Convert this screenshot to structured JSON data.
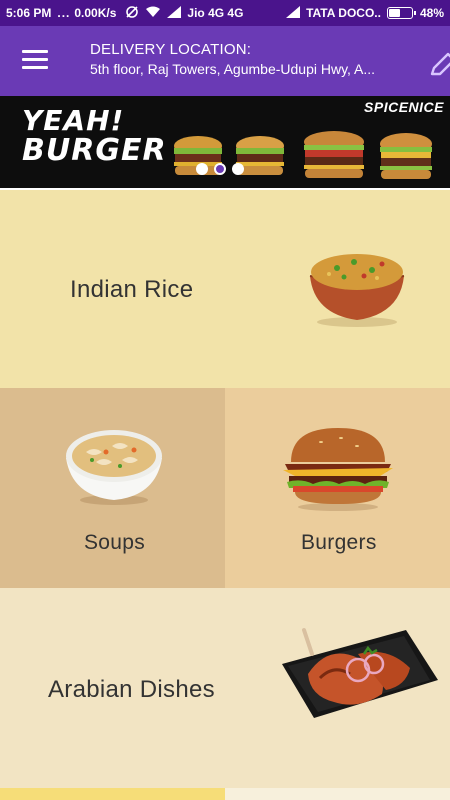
{
  "status_bar": {
    "time": "5:06 PM",
    "dots": "...",
    "speed": "0.00K/s",
    "carrier1": "Jio 4G 4G",
    "carrier2": "TATA DOCO..",
    "battery": "48%",
    "battery_level": 0.48
  },
  "app_bar": {
    "menu_icon": "hamburger-menu-icon",
    "location_title": "DELIVERY LOCATION:",
    "location_address": "5th floor, Raj Towers, Agumbe-Udupi Hwy, A...",
    "edit_icon": "pencil-icon",
    "color": "#6a3ab5"
  },
  "banner": {
    "headline_line1": "YEAH!",
    "headline_line2": "BURGER",
    "brand": "SPICENICE",
    "active_slide": 2,
    "slide_count": 3
  },
  "categories": [
    {
      "label": "Indian Rice",
      "image": "biryani-bowl",
      "color": "#f2e3a9"
    },
    {
      "label": "Soups",
      "image": "soup-bowl",
      "color": "#dbbc8e"
    },
    {
      "label": "Burgers",
      "image": "burger",
      "color": "#ebcd9c"
    },
    {
      "label": "Arabian Dishes",
      "image": "grilled-chicken-tray",
      "color": "#f2e4c3"
    }
  ]
}
